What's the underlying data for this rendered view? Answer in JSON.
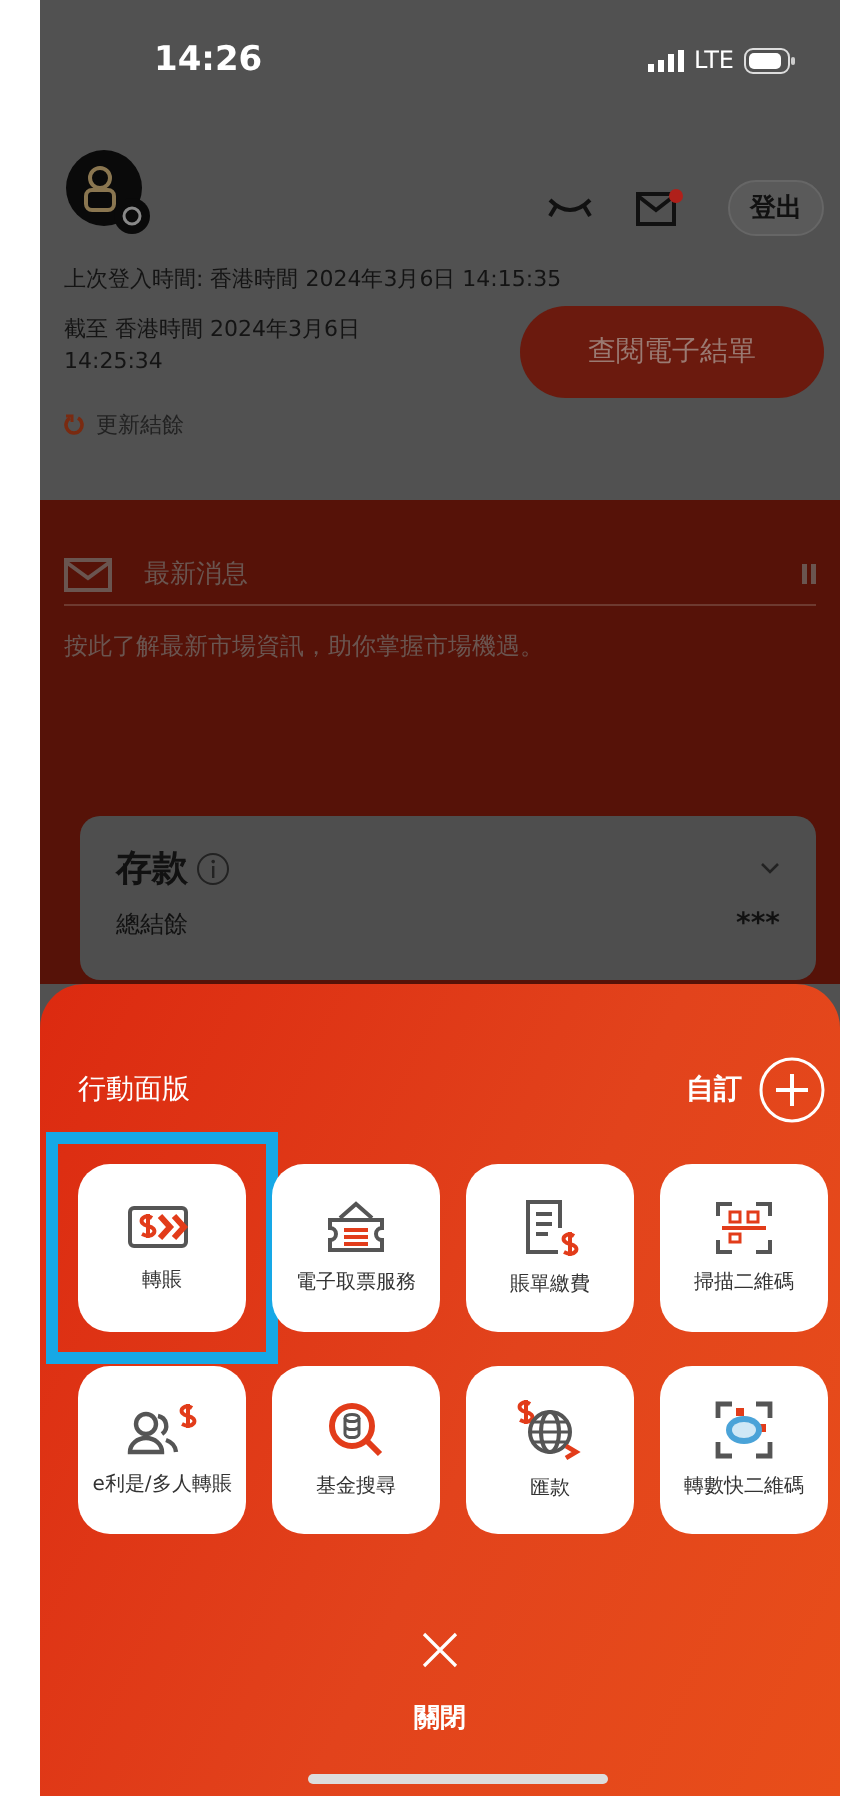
{
  "status_bar": {
    "time": "14:26",
    "network": "LTE"
  },
  "header": {
    "logout": "登出",
    "mail_unread": true,
    "last_login": "上次登入時間: 香港時間 2024年3月6日 14:15:35",
    "as_of": "截至 香港時間 2024年3月6日",
    "as_of_time": "14:25:34",
    "statement_button": "查閱電子結單",
    "refresh": "更新結餘"
  },
  "news": {
    "title": "最新消息",
    "message": "按此了解最新市場資訊，助你掌握市場機遇。"
  },
  "deposit": {
    "title": "存款",
    "label": "總結餘",
    "value": "***"
  },
  "panel": {
    "title": "行動面版",
    "customize": "自訂",
    "close": "關閉",
    "actions": [
      {
        "label": "轉賬",
        "kind": "transfer",
        "highlighted": true
      },
      {
        "label": "電子取票服務",
        "kind": "ticket",
        "highlighted": false
      },
      {
        "label": "賬單繳費",
        "kind": "bill",
        "highlighted": false
      },
      {
        "label": "掃描二維碼",
        "kind": "scan",
        "highlighted": false
      },
      {
        "label": "e利是/多人轉賬",
        "kind": "people",
        "highlighted": false
      },
      {
        "label": "基金搜尋",
        "kind": "fund",
        "highlighted": false
      },
      {
        "label": "匯款",
        "kind": "remit",
        "highlighted": false
      },
      {
        "label": "轉數快二維碼",
        "kind": "fps",
        "highlighted": false
      }
    ]
  }
}
